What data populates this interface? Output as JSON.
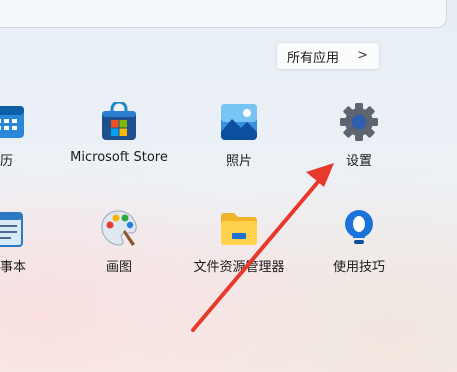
{
  "start_menu": {
    "all_apps_label": "所有应用",
    "all_apps_chevron": ">",
    "apps": [
      {
        "label": "历",
        "icon": "calendar-icon"
      },
      {
        "label": "Microsoft Store",
        "icon": "microsoft-store-icon"
      },
      {
        "label": "照片",
        "icon": "photos-icon"
      },
      {
        "label": "设置",
        "icon": "gear-icon"
      },
      {
        "label": "事本",
        "icon": "notepad-icon"
      },
      {
        "label": "画图",
        "icon": "paint-palette-icon"
      },
      {
        "label": "文件资源管理器",
        "icon": "folder-icon"
      },
      {
        "label": "使用技巧",
        "icon": "lightbulb-icon"
      }
    ]
  },
  "annotation": {
    "color": "#e8392c",
    "icon": "red-arrow-pointer"
  },
  "colors": {
    "accent": "#0067c0",
    "background": "#e9eff5"
  }
}
